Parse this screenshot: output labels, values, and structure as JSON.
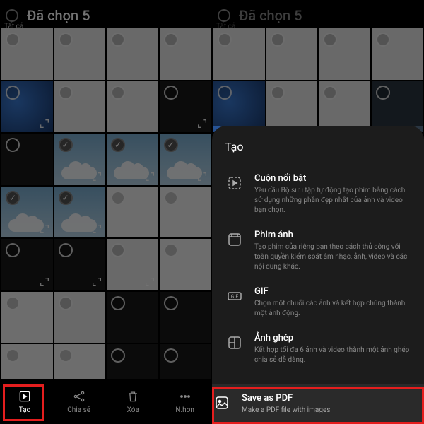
{
  "left": {
    "all_label": "Tất cả",
    "title": "Đã chọn 5",
    "bottombar": [
      {
        "label": "Tạo",
        "active": true
      },
      {
        "label": "Chia sẻ",
        "active": false
      },
      {
        "label": "Xóa",
        "active": false
      },
      {
        "label": "N.hơn",
        "active": false
      }
    ]
  },
  "right": {
    "all_label": "Tất cả",
    "title": "Đã chọn 5",
    "sheet_title": "Tạo",
    "options": [
      {
        "title": "Cuộn nổi bật",
        "desc": "Yêu cầu Bộ sưu tập tự động tạo phim bằng cách sử dụng những phần đẹp nhất của ảnh và video bạn chọn."
      },
      {
        "title": "Phim ảnh",
        "desc": "Tạo phim của riêng bạn theo cách thủ công với toàn quyền kiểm soát âm nhạc, ảnh, video và các nội dung khác."
      },
      {
        "title": "GIF",
        "desc": "Chọn một chuỗi các ảnh và kết hợp chúng thành một ảnh động."
      },
      {
        "title": "Ảnh ghép",
        "desc": "Kết hợp tối đa 6 ảnh và video thành một ảnh ghép chia sẻ dễ dàng."
      },
      {
        "title": "Save as PDF",
        "desc": "Make a PDF file with images"
      }
    ]
  }
}
